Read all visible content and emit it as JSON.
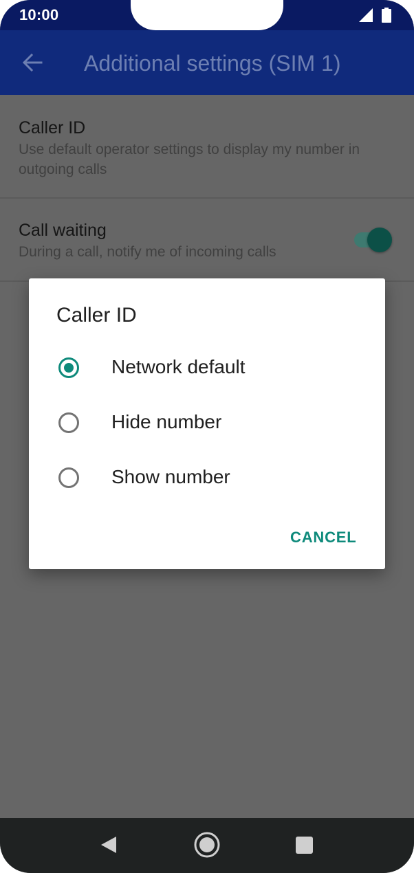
{
  "status_bar": {
    "time": "10:00"
  },
  "app_bar": {
    "title": "Additional settings (SIM 1)"
  },
  "settings": [
    {
      "title": "Caller ID",
      "subtitle": "Use default operator settings to display my number in outgoing calls"
    },
    {
      "title": "Call waiting",
      "subtitle": "During a call, notify me of incoming calls",
      "toggle_on": true
    }
  ],
  "dialog": {
    "title": "Caller ID",
    "options": [
      {
        "label": "Network default",
        "selected": true
      },
      {
        "label": "Hide number",
        "selected": false
      },
      {
        "label": "Show number",
        "selected": false
      }
    ],
    "cancel_label": "CANCEL"
  },
  "colors": {
    "accent": "#0e8a7b",
    "app_bar": "#102a7c",
    "status_bar": "#0a1a62",
    "scrim": "#666666",
    "nav_bar": "#1f2222"
  }
}
